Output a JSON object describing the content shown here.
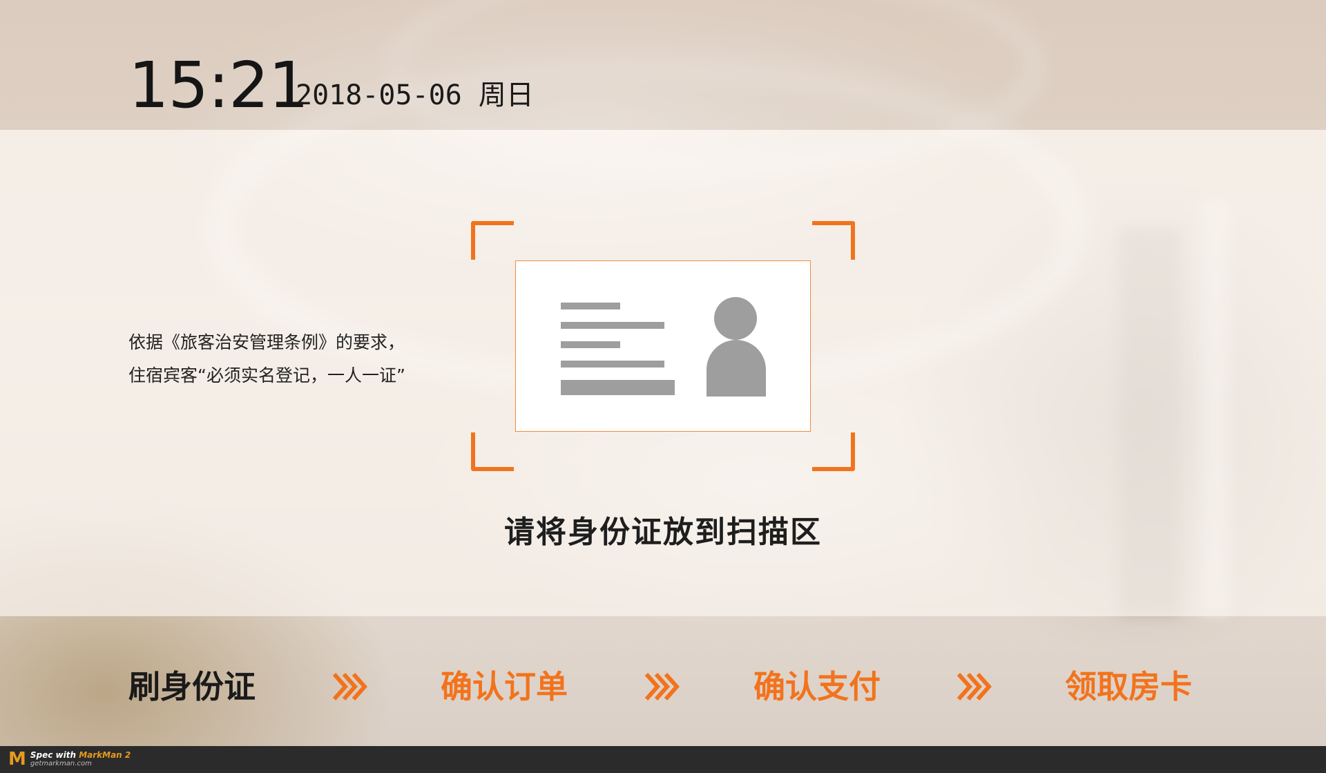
{
  "header": {
    "time": "15:21",
    "date": "2018-05-06 周日"
  },
  "notice": {
    "line1": "依据《旅客治安管理条例》的要求，",
    "line2": "住宿宾客“必须实名登记，一人一证”"
  },
  "scan": {
    "prompt": "请将身份证放到扫描区",
    "accent_color": "#f2731d"
  },
  "steps": [
    {
      "label": "刷身份证",
      "state": "active"
    },
    {
      "label": "确认订单",
      "state": "pending"
    },
    {
      "label": "确认支付",
      "state": "pending"
    },
    {
      "label": "领取房卡",
      "state": "pending"
    }
  ],
  "footer": {
    "logo": "M",
    "spec_prefix": "Spec with ",
    "spec_brand": "MarkMan 2",
    "site": "getmarkman.com"
  }
}
